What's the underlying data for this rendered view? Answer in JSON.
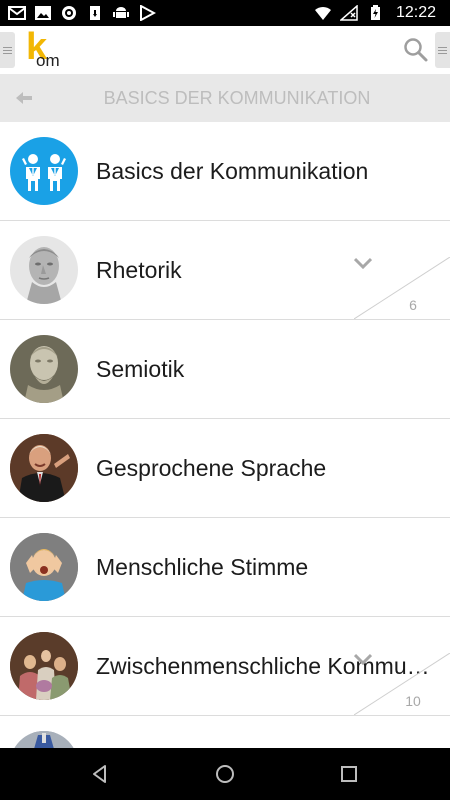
{
  "status_bar": {
    "time": "12:22",
    "left_icons": [
      "gmail-icon",
      "image-icon",
      "sync-icon",
      "sd-card-icon",
      "android-icon",
      "play-store-icon"
    ],
    "right_icons": [
      "wifi-icon",
      "no-signal-icon",
      "battery-charging-icon"
    ]
  },
  "app_bar": {
    "logo_k": "k",
    "logo_om": "om"
  },
  "sub_header": {
    "title": "BASICS DER KOMMUNIKATION"
  },
  "list": {
    "items": [
      {
        "label": "Basics der Kommunikation",
        "icon": "communication-people-icon",
        "count": ""
      },
      {
        "label": "Rhetorik",
        "icon": "roman-bust-image",
        "count": "6"
      },
      {
        "label": "Semiotik",
        "icon": "greek-bust-image",
        "count": ""
      },
      {
        "label": "Gesprochene Sprache",
        "icon": "speaker-photo",
        "count": ""
      },
      {
        "label": "Menschliche Stimme",
        "icon": "child-photo",
        "count": ""
      },
      {
        "label": "Zwischenmenschliche Kommunikation",
        "icon": "painting-image",
        "count": "10"
      }
    ]
  },
  "colors": {
    "accent": "#f2b705",
    "avatar_blue": "#1aa1e6",
    "subheader_bg": "#e8e8e8",
    "subheader_text": "#bdbdbd"
  }
}
